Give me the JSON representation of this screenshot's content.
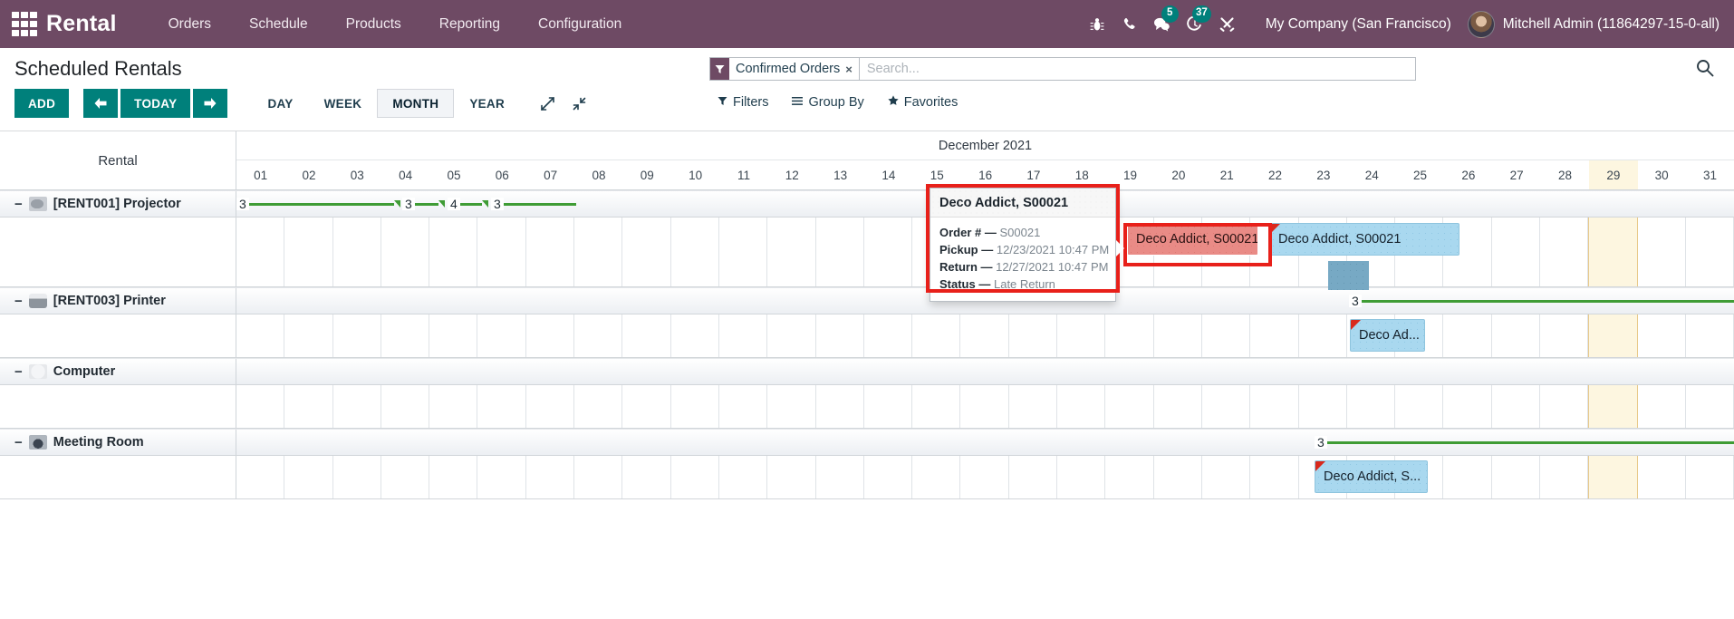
{
  "navbar": {
    "apps_icon": "apps-grid-icon",
    "brand": "Rental",
    "menu": [
      {
        "label": "Orders"
      },
      {
        "label": "Schedule"
      },
      {
        "label": "Products"
      },
      {
        "label": "Reporting"
      },
      {
        "label": "Configuration"
      }
    ],
    "sysicons": [
      {
        "name": "bug-icon",
        "badge": null
      },
      {
        "name": "phone-icon",
        "badge": null
      },
      {
        "name": "messages-icon",
        "badge": "5"
      },
      {
        "name": "activities-clock-icon",
        "badge": "37"
      },
      {
        "name": "tools-icon",
        "badge": null
      }
    ],
    "company": "My Company (San Francisco)",
    "user": "Mitchell Admin (11864297-15-0-all)",
    "bg_color": "#6e4a64",
    "badge_color": "#00807b"
  },
  "control_panel": {
    "title": "Scheduled Rentals",
    "add_label": "ADD",
    "prev_label": "←",
    "today_label": "TODAY",
    "next_label": "→",
    "scales": [
      {
        "label": "DAY",
        "active": false
      },
      {
        "label": "WEEK",
        "active": false
      },
      {
        "label": "MONTH",
        "active": true
      },
      {
        "label": "YEAR",
        "active": false
      }
    ],
    "expand_icon": "expand-arrows-icon",
    "collapse_icon": "collapse-arrows-icon",
    "primary_color": "#00807b"
  },
  "search": {
    "facet_icon": "filter-funnel-icon",
    "facet_label": "Confirmed Orders",
    "facet_remove": "×",
    "placeholder": "Search...",
    "value": "",
    "search_icon": "search-icon"
  },
  "search_menus": [
    {
      "icon": "filter-icon",
      "label": "Filters"
    },
    {
      "icon": "group-by-icon",
      "label": "Group By"
    },
    {
      "icon": "star-icon",
      "label": "Favorites"
    }
  ],
  "gantt": {
    "row_header": "Rental",
    "period_label": "December 2021",
    "days": [
      "01",
      "02",
      "03",
      "04",
      "05",
      "06",
      "07",
      "08",
      "09",
      "10",
      "11",
      "12",
      "13",
      "14",
      "15",
      "16",
      "17",
      "18",
      "19",
      "20",
      "21",
      "22",
      "23",
      "24",
      "25",
      "26",
      "27",
      "28",
      "29",
      "30",
      "31"
    ],
    "today_day": "29",
    "groups": [
      {
        "thumb": "thumb-projector",
        "toggle": "−",
        "name": "[RENT001] Projector"
      },
      {
        "thumb": "thumb-printer",
        "toggle": "−",
        "name": "[RENT003] Printer"
      },
      {
        "thumb": "thumb-computer",
        "toggle": "−",
        "name": "Computer"
      },
      {
        "thumb": "thumb-meeting",
        "toggle": "−",
        "name": "Meeting Room"
      }
    ],
    "pills": [
      {
        "label": "Deco Addict, S00021",
        "color": "red",
        "selected": true
      },
      {
        "label": "Deco Addict, S00021",
        "color": "blue",
        "selected": false
      },
      {
        "label": "Deco Ad...",
        "color": "blue",
        "selected": false
      },
      {
        "label": "Deco Addict, S...",
        "color": "blue",
        "selected": false
      }
    ],
    "consolidations": [
      {
        "count": "3"
      },
      {
        "count": "3"
      },
      {
        "count": "4"
      },
      {
        "count": "3"
      },
      {
        "count": "3"
      },
      {
        "count": "3"
      }
    ],
    "colors": {
      "late": "#e98b86",
      "normal": "#a9d8ef",
      "consolidation_line": "#3f9c35",
      "today_column": "#fdf6e0",
      "selection": "#e8201a"
    }
  },
  "tooltip": {
    "title": "Deco Addict, S00021",
    "rows": [
      {
        "label": "Order #",
        "sep": "—",
        "value": "S00021"
      },
      {
        "label": "Pickup",
        "sep": "—",
        "value": "12/23/2021 10:47 PM"
      },
      {
        "label": "Return",
        "sep": "—",
        "value": "12/27/2021 10:47 PM"
      },
      {
        "label": "Status",
        "sep": "—",
        "value": "Late Return"
      }
    ]
  }
}
